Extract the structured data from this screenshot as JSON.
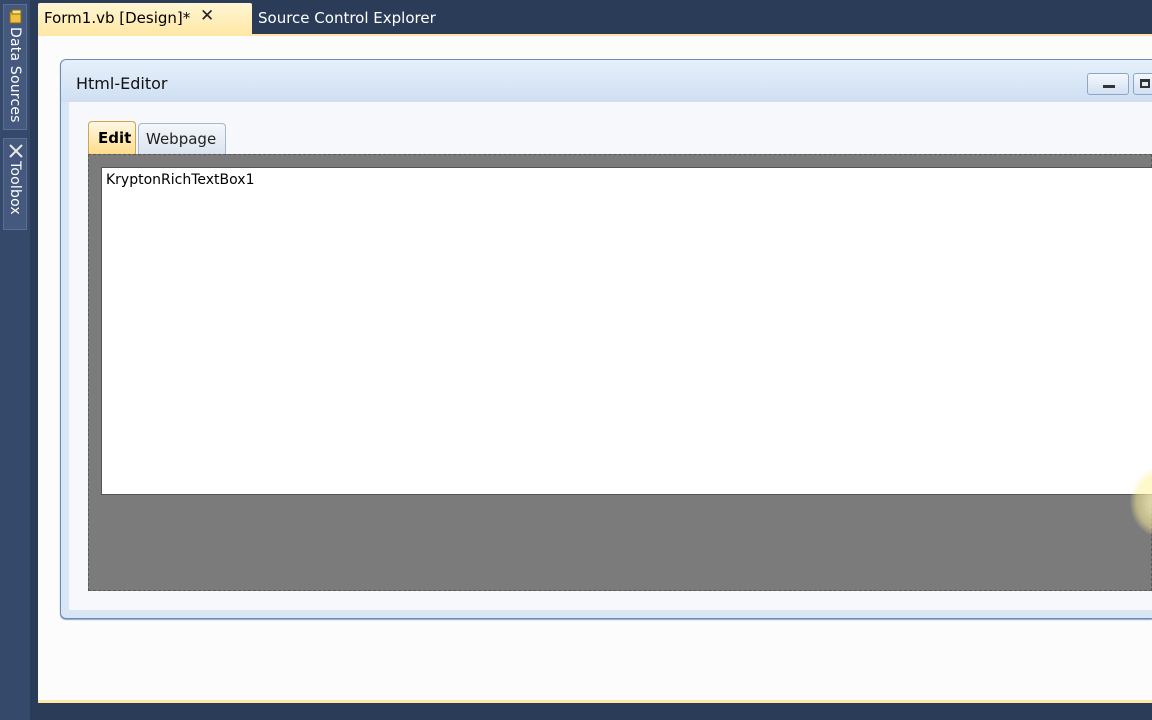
{
  "side_panel": {
    "data_sources_label": "Data Sources",
    "toolbox_label": "Toolbox"
  },
  "document_tabs": {
    "active_label": "Form1.vb [Design]*",
    "close_glyph": "✕",
    "inactive_label": "Source Control Explorer"
  },
  "form": {
    "title": "Html-Editor",
    "tabs": [
      {
        "label": "Edit",
        "selected": true
      },
      {
        "label": "Webpage",
        "selected": false
      }
    ],
    "rich_textbox_text": "KryptonRichTextBox1"
  },
  "colors": {
    "ide_background": "#2b3c59",
    "active_tab": "#ffe8a6",
    "panel_gray": "#7b7b7b"
  }
}
